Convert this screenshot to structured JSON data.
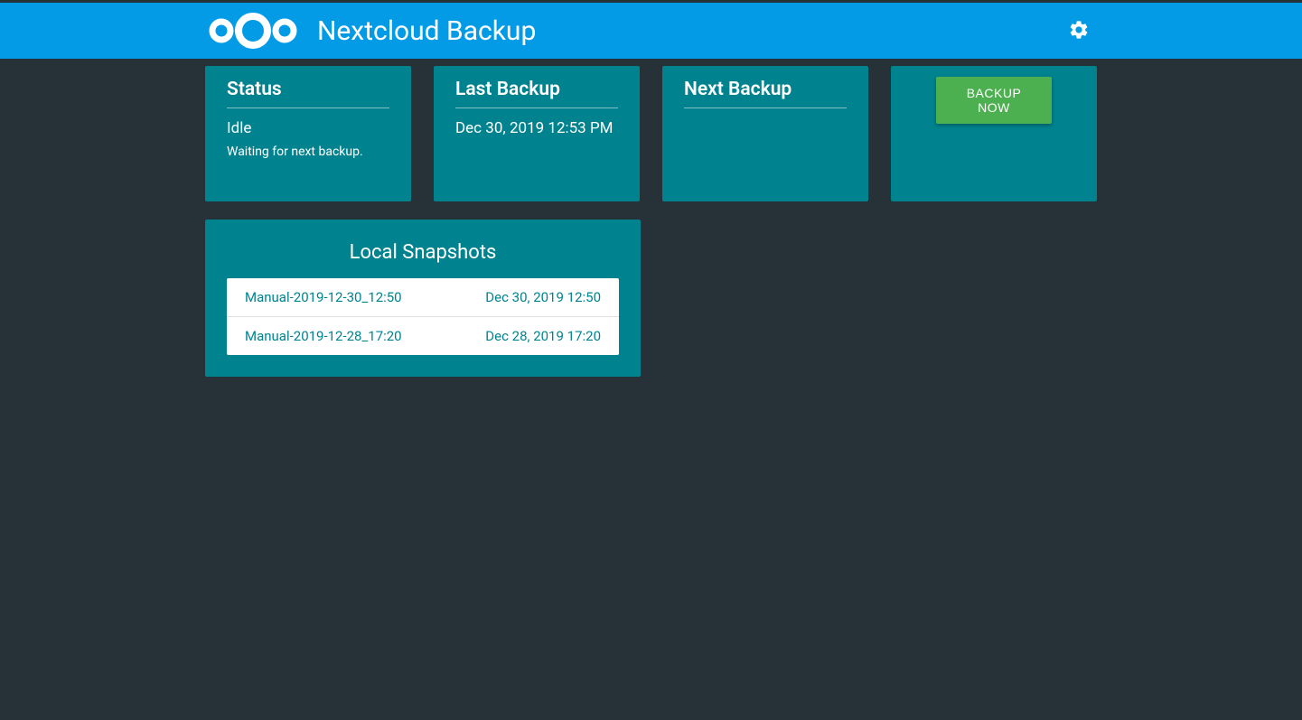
{
  "header": {
    "title": "Nextcloud Backup"
  },
  "cards": {
    "status": {
      "title": "Status",
      "state": "Idle",
      "subtext": "Waiting for next backup."
    },
    "lastBackup": {
      "title": "Last Backup",
      "value": "Dec 30, 2019 12:53 PM"
    },
    "nextBackup": {
      "title": "Next Backup",
      "value": ""
    },
    "action": {
      "buttonLabel": "BACKUP NOW"
    }
  },
  "snapshots": {
    "title": "Local Snapshots",
    "items": [
      {
        "name": "Manual-2019-12-30_12:50",
        "date": "Dec 30, 2019 12:50"
      },
      {
        "name": "Manual-2019-12-28_17:20",
        "date": "Dec 28, 2019 17:20"
      }
    ]
  }
}
